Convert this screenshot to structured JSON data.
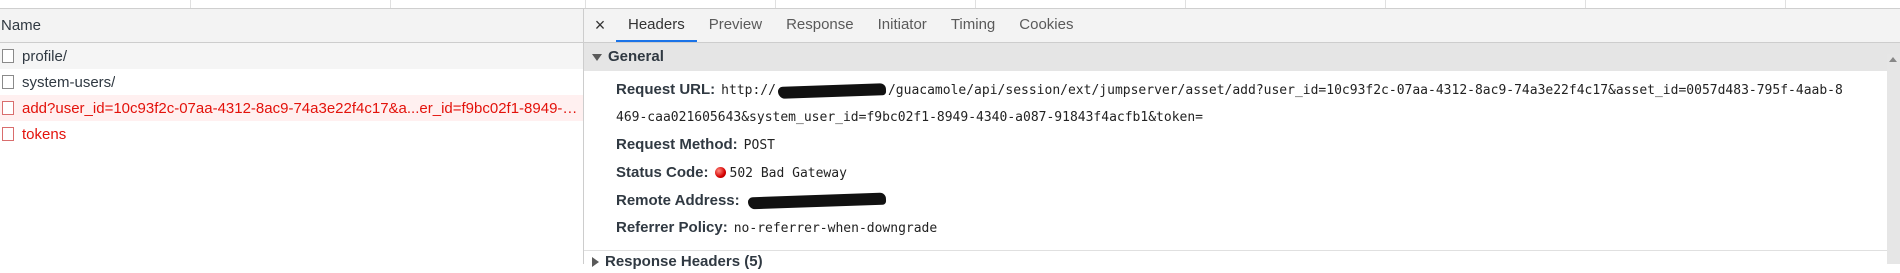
{
  "request_list": {
    "header": "Name",
    "rows": [
      {
        "name": "profile/",
        "state": "normal"
      },
      {
        "name": "system-users/",
        "state": "normal"
      },
      {
        "name": "add?user_id=10c93f2c-07aa-4312-8ac9-74a3e22f4c17&a...er_id=f9bc02f1-8949-4...",
        "state": "error-selected"
      },
      {
        "name": "tokens",
        "state": "error"
      }
    ]
  },
  "details": {
    "close_glyph": "×",
    "tabs": [
      "Headers",
      "Preview",
      "Response",
      "Initiator",
      "Timing",
      "Cookies"
    ],
    "active_tab": "Headers",
    "general": {
      "title": "General",
      "request_url_label": "Request URL:",
      "request_url_prefix": "http://",
      "request_url_line1": "/guacamole/api/session/ext/jumpserver/asset/add?user_id=10c93f2c-07aa-4312-8ac9-74a3e22f4c17&asset_id=0057d483-795f-4aab-8",
      "request_url_line2": "469-caa021605643&system_user_id=f9bc02f1-8949-4340-a087-91843f4acfb1&token=",
      "request_method_label": "Request Method:",
      "request_method_value": "POST",
      "status_code_label": "Status Code:",
      "status_code_value": "502 Bad Gateway",
      "remote_address_label": "Remote Address:",
      "referrer_policy_label": "Referrer Policy:",
      "referrer_policy_value": "no-referrer-when-downgrade"
    },
    "response_headers_title": "Response Headers (5)"
  },
  "colors": {
    "error_text": "#e3120b",
    "active_tab_underline": "#1a73e8",
    "section_bg": "#e5e5e5"
  }
}
